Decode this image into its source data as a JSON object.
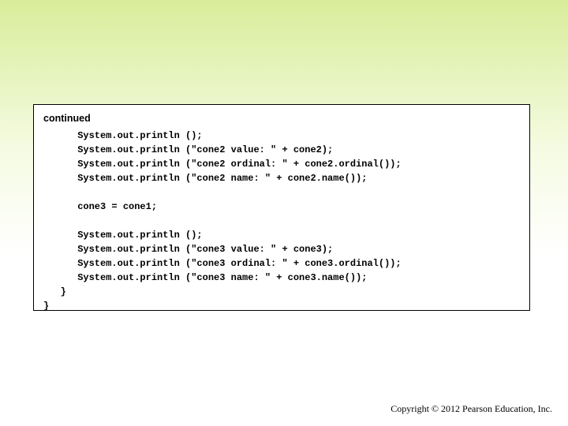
{
  "continued_label": "continued",
  "code": {
    "l01": "      System.out.println ();",
    "l02": "      System.out.println (\"cone2 value: \" + cone2);",
    "l03": "      System.out.println (\"cone2 ordinal: \" + cone2.ordinal());",
    "l04": "      System.out.println (\"cone2 name: \" + cone2.name());",
    "l05": "",
    "l06": "      cone3 = cone1;",
    "l07": "",
    "l08": "      System.out.println ();",
    "l09": "      System.out.println (\"cone3 value: \" + cone3);",
    "l10": "      System.out.println (\"cone3 ordinal: \" + cone3.ordinal());",
    "l11": "      System.out.println (\"cone3 name: \" + cone3.name());",
    "l12": "   }",
    "l13": "}"
  },
  "copyright": "Copyright © 2012 Pearson Education, Inc."
}
